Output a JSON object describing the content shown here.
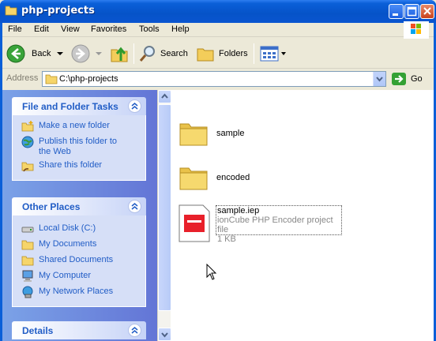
{
  "window": {
    "title": "php-projects",
    "icons": {
      "title": "folder-icon",
      "minimize": "minimize-icon",
      "maximize": "maximize-icon",
      "close": "close-icon"
    }
  },
  "menu": {
    "items": [
      "File",
      "Edit",
      "View",
      "Favorites",
      "Tools",
      "Help"
    ]
  },
  "toolbar": {
    "back_label": "Back",
    "search_label": "Search",
    "folders_label": "Folders"
  },
  "address": {
    "label": "Address",
    "value": "C:\\php-projects",
    "go_label": "Go"
  },
  "left_pane": {
    "panels": [
      {
        "title": "File and Folder Tasks",
        "tasks": [
          {
            "label": "Make a new folder",
            "icon": "new-folder-icon"
          },
          {
            "label": "Publish this folder to the Web",
            "icon": "publish-web-icon"
          },
          {
            "label": "Share this folder",
            "icon": "share-folder-icon"
          }
        ]
      },
      {
        "title": "Other Places",
        "tasks": [
          {
            "label": "Local Disk (C:)",
            "icon": "disk-icon"
          },
          {
            "label": "My Documents",
            "icon": "folder-icon"
          },
          {
            "label": "Shared Documents",
            "icon": "folder-icon"
          },
          {
            "label": "My Computer",
            "icon": "computer-icon"
          },
          {
            "label": "My Network Places",
            "icon": "network-icon"
          }
        ]
      },
      {
        "title": "Details",
        "tasks": []
      }
    ]
  },
  "files": [
    {
      "name": "sample",
      "type": "folder"
    },
    {
      "name": "encoded",
      "type": "folder"
    },
    {
      "name": "sample.iep",
      "type": "file",
      "description": "ionCube PHP Encoder project file",
      "size": "1 KB"
    }
  ],
  "colors": {
    "titlebar": "#0a5fd8",
    "task_link": "#215dc6",
    "panel_body": "#d6dff7",
    "iep_red": "#e8202a"
  }
}
